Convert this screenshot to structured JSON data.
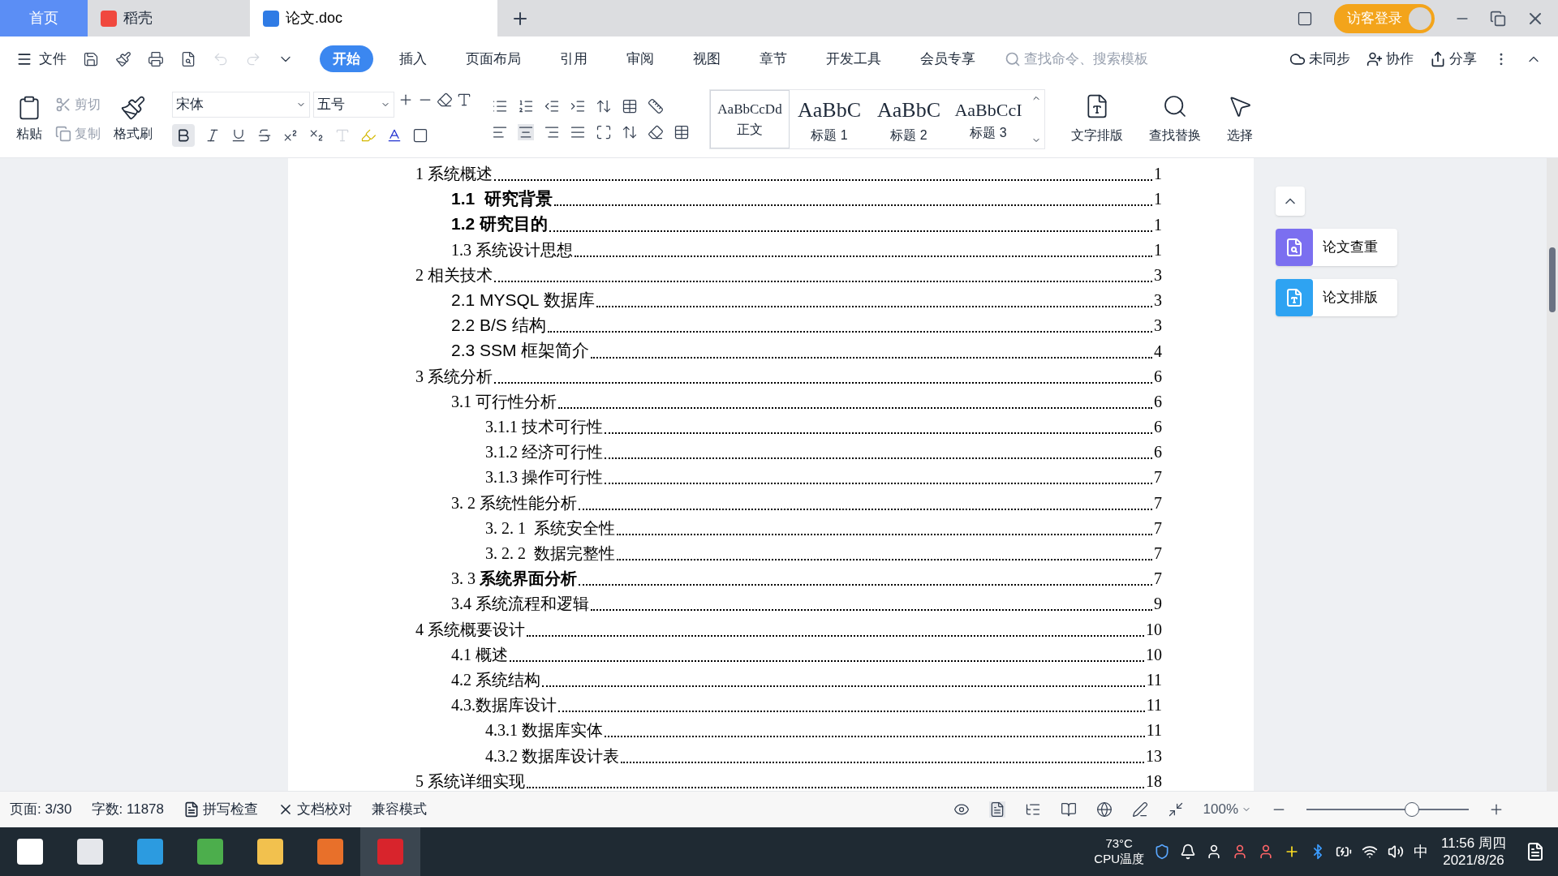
{
  "tabs": [
    {
      "label": "首页",
      "kind": "home",
      "selected": false
    },
    {
      "label": "稻壳",
      "kind": "docer",
      "selected": false
    },
    {
      "label": "论文.doc",
      "kind": "doc",
      "selected": true
    }
  ],
  "title_bar": {
    "login": "访客登录"
  },
  "menu": {
    "file": "文件",
    "items": [
      {
        "label": "开始",
        "selected": true
      },
      {
        "label": "插入",
        "selected": false
      },
      {
        "label": "页面布局",
        "selected": false
      },
      {
        "label": "引用",
        "selected": false
      },
      {
        "label": "审阅",
        "selected": false
      },
      {
        "label": "视图",
        "selected": false
      },
      {
        "label": "章节",
        "selected": false
      },
      {
        "label": "开发工具",
        "selected": false
      },
      {
        "label": "会员专享",
        "selected": false
      }
    ],
    "search": {
      "placeholder": "查找命令、搜索模板"
    },
    "actions": [
      "未同步",
      "协作",
      "分享"
    ]
  },
  "ribbon": {
    "paste": "粘贴",
    "cut": "剪切",
    "copy": "复制",
    "format_painter": "格式刷",
    "font": "宋体",
    "size": "五号",
    "styles": [
      {
        "sample": "AaBbCcDd",
        "label": "正文",
        "selected": true
      },
      {
        "sample": "AaBbC",
        "label": "标题 1",
        "selected": false
      },
      {
        "sample": "AaBbC",
        "label": "标题 2",
        "selected": false
      },
      {
        "sample": "AaBbCcI",
        "label": "标题 3",
        "selected": false
      }
    ],
    "text_layout": "文字排版",
    "find_replace": "查找替换",
    "select": "选择"
  },
  "toc": [
    {
      "text": "1 系统概述",
      "page": "1",
      "kind": "serif",
      "bold": false,
      "children": [
        {
          "text": "1.1  研究背景",
          "page": "1",
          "kind": "sans",
          "bold": true
        },
        {
          "text": "1.2 研究目的",
          "page": "1",
          "kind": "sans",
          "bold": true
        },
        {
          "text": "1.3 系统设计思想",
          "page": "1",
          "kind": "serif",
          "bold": false
        }
      ]
    },
    {
      "text": "2 相关技术",
      "page": "3",
      "kind": "serif",
      "bold": false,
      "children": [
        {
          "text": "2.1 MYSQL 数据库",
          "page": "3",
          "kind": "sans",
          "bold": false
        },
        {
          "text": "2.2 B/S 结构",
          "page": "3",
          "kind": "sans",
          "bold": false
        },
        {
          "text": "2.3 SSM 框架简介",
          "page": "4",
          "kind": "sans",
          "bold": false
        }
      ]
    },
    {
      "text": "3 系统分析",
      "page": "6",
      "kind": "serif",
      "bold": false,
      "children": [
        {
          "text": "3.1 可行性分析",
          "page": "6",
          "kind": "serif",
          "bold": false,
          "children": [
            {
              "text": "3.1.1 技术可行性",
              "page": "6",
              "kind": "serif",
              "bold": false
            },
            {
              "text": "3.1.2 经济可行性",
              "page": "6",
              "kind": "serif",
              "bold": false
            },
            {
              "text": "3.1.3 操作可行性",
              "page": "7",
              "kind": "serif",
              "bold": false
            }
          ]
        },
        {
          "text": "3. 2 系统性能分析",
          "page": "7",
          "kind": "serif",
          "bold": false,
          "children": [
            {
              "text": "3. 2. 1  系统安全性",
              "page": "7",
              "kind": "serif",
              "bold": false
            },
            {
              "text": "3. 2. 2  数据完整性",
              "page": "7",
              "kind": "serif",
              "bold": false
            }
          ]
        },
        {
          "text": "3. 3 **系统界面分析**",
          "page": "7",
          "kind": "serif",
          "bold": false
        },
        {
          "text": "3.4 系统流程和逻辑",
          "page": "9",
          "kind": "serif",
          "bold": false
        }
      ]
    },
    {
      "text": "4 系统概要设计",
      "page": "10",
      "kind": "serif",
      "bold": false,
      "children": [
        {
          "text": "4.1 概述",
          "page": "10",
          "kind": "serif",
          "bold": false
        },
        {
          "text": "4.2 系统结构",
          "page": "11",
          "kind": "serif",
          "bold": false
        },
        {
          "text": "4.3.数据库设计",
          "page": "11",
          "kind": "serif",
          "bold": false,
          "children": [
            {
              "text": "4.3.1 数据库实体",
              "page": "11",
              "kind": "serif",
              "bold": false
            },
            {
              "text": "4.3.2 数据库设计表",
              "page": "13",
              "kind": "serif",
              "bold": false
            }
          ]
        }
      ]
    },
    {
      "text": "5 系统详细实现",
      "page": "18",
      "kind": "serif",
      "bold": false
    }
  ],
  "side_panel": [
    {
      "label": "论文查重",
      "color": "#7b6ff0"
    },
    {
      "label": "论文排版",
      "color": "#2ea3f2"
    }
  ],
  "status_bar": {
    "page": "页面: 3/30",
    "words": "字数: 11878",
    "spell": "拼写检查",
    "proof": "文档校对",
    "compat": "兼容模式",
    "zoom": "100%",
    "level": 0.65
  },
  "taskbar": {
    "temp": "73°C",
    "temp_label": "CPU温度",
    "ime": "中",
    "time": "11:56 周四",
    "date": "2021/8/26"
  }
}
